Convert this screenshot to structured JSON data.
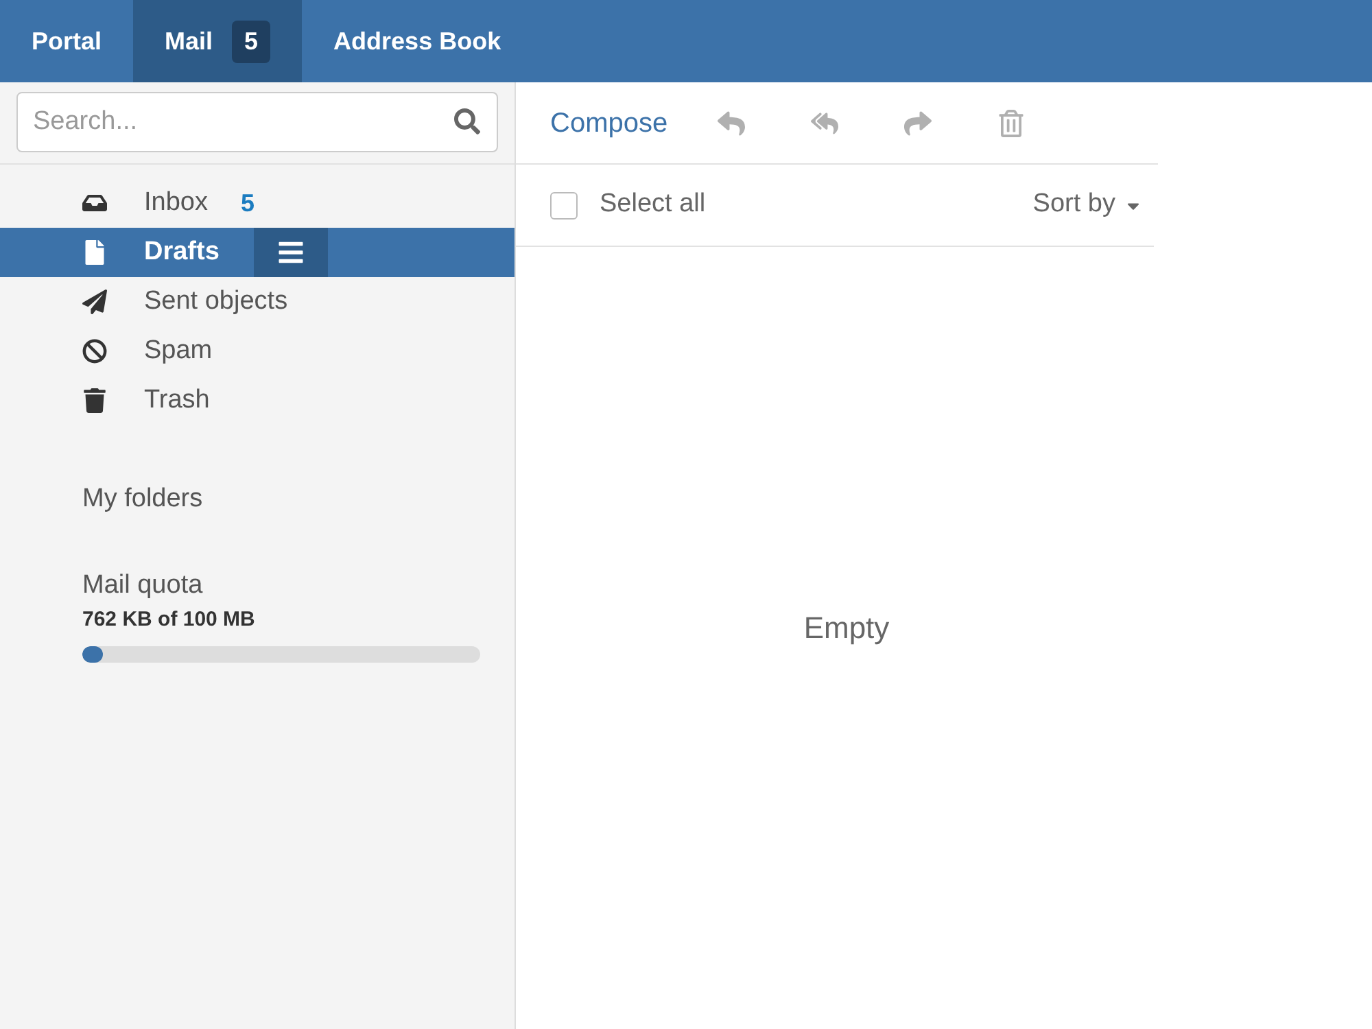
{
  "tabs": [
    {
      "label": "Portal",
      "selected": false
    },
    {
      "label": "Mail",
      "selected": true,
      "badge": "5"
    },
    {
      "label": "Address Book",
      "selected": false
    }
  ],
  "search": {
    "placeholder": "Search..."
  },
  "folders": [
    {
      "kind": "inbox",
      "label": "Inbox",
      "count": "5",
      "selected": false
    },
    {
      "kind": "drafts",
      "label": "Drafts",
      "selected": true
    },
    {
      "kind": "sent",
      "label": "Sent objects",
      "selected": false
    },
    {
      "kind": "spam",
      "label": "Spam",
      "selected": false
    },
    {
      "kind": "trash",
      "label": "Trash",
      "selected": false
    }
  ],
  "my_folders": {
    "label": "My folders"
  },
  "quota": {
    "label": "Mail quota",
    "reading": "762 KB of 100 MB",
    "level": 0.05
  },
  "toolbar": {
    "compose": "Compose",
    "actions": [
      {
        "kind": "reply",
        "disabled": true
      },
      {
        "kind": "reply_all",
        "disabled": true
      },
      {
        "kind": "forward",
        "disabled": true
      },
      {
        "kind": "delete",
        "disabled": true
      }
    ]
  },
  "list_header": {
    "select_all": {
      "label": "Select all",
      "checked": false
    },
    "sort": {
      "label": "Sort by"
    }
  },
  "message_list": {
    "empty_text": "Empty"
  }
}
